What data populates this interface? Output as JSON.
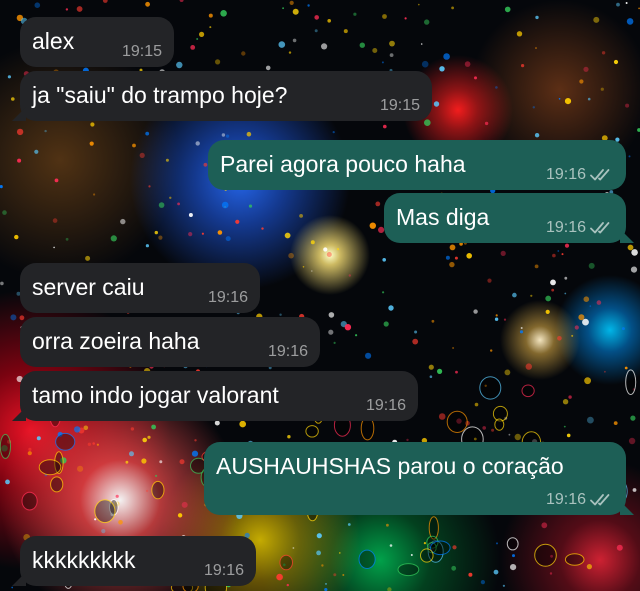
{
  "messages": [
    {
      "direction": "incoming",
      "text": "alex",
      "time": "19:15",
      "read_icon": ""
    },
    {
      "direction": "incoming",
      "text": "ja \"saiu\" do trampo hoje?",
      "time": "19:15",
      "read_icon": ""
    },
    {
      "direction": "outgoing",
      "text": "Parei agora pouco haha",
      "time": "19:16",
      "read_icon": "double-check-icon"
    },
    {
      "direction": "outgoing",
      "text": "Mas diga",
      "time": "19:16",
      "read_icon": "double-check-icon"
    },
    {
      "direction": "incoming",
      "text": "server caiu",
      "time": "19:16",
      "read_icon": ""
    },
    {
      "direction": "incoming",
      "text": "orra zoeira haha",
      "time": "19:16",
      "read_icon": ""
    },
    {
      "direction": "incoming",
      "text": "tamo indo jogar valorant",
      "time": "19:16",
      "read_icon": ""
    },
    {
      "direction": "outgoing",
      "text": "AUSHAUHSHAS parou o coração",
      "time": "19:16",
      "read_icon": "double-check-icon"
    },
    {
      "direction": "incoming",
      "text": "kkkkkkkkk",
      "time": "19:16",
      "read_icon": ""
    }
  ],
  "colors": {
    "incoming_bubble": "#232427",
    "outgoing_bubble": "#1d5f56",
    "text": "#ffffff",
    "timestamp": "#9a9ba0"
  }
}
